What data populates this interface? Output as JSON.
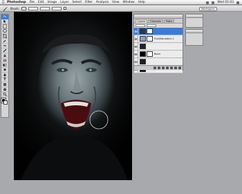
{
  "menubar": {
    "app_name": "Photoshop",
    "items": [
      "File",
      "Edit",
      "Image",
      "Layer",
      "Select",
      "Filter",
      "Analysis",
      "View",
      "Window",
      "Help"
    ],
    "clock": "Wed 01:03"
  },
  "options_bar": {
    "brush_label": "Brush:",
    "workspace_label": "Workspace"
  },
  "layers_panel": {
    "tabs": [
      "Layers",
      "Channels",
      "Paths"
    ],
    "layers": [
      {
        "name": "",
        "selected": true,
        "thumb_color": "#2a3a48",
        "has_mask": true
      },
      {
        "name": "Hue/Saturation 1",
        "selected": false,
        "thumb_color": "#8fa3b3",
        "has_mask": true
      },
      {
        "name": "",
        "selected": false,
        "thumb_color": "#1a2430",
        "has_mask": false
      },
      {
        "name": "Black",
        "selected": false,
        "thumb_color": "#000000",
        "has_mask": true
      },
      {
        "name": "",
        "selected": false,
        "thumb_color": "#1d1f22",
        "has_mask": false
      },
      {
        "name": "Background",
        "selected": false,
        "thumb_color": "#0e0e0e",
        "has_mask": false
      }
    ]
  },
  "colors": {
    "workspace_bg": "#a7a9ad",
    "selection_blue": "#3b7ad9",
    "foreground": "#000000",
    "background": "#ffffff"
  },
  "icons": [
    "apple-icon",
    "brush-tool-icon",
    "move-tool-icon",
    "marquee-tool-icon",
    "lasso-tool-icon",
    "crop-tool-icon",
    "eyedropper-icon",
    "heal-icon",
    "brush-icon",
    "stamp-icon",
    "eraser-icon",
    "gradient-icon",
    "dodge-icon",
    "pen-icon",
    "type-icon",
    "shape-icon",
    "hand-icon",
    "zoom-icon",
    "eye-icon"
  ]
}
